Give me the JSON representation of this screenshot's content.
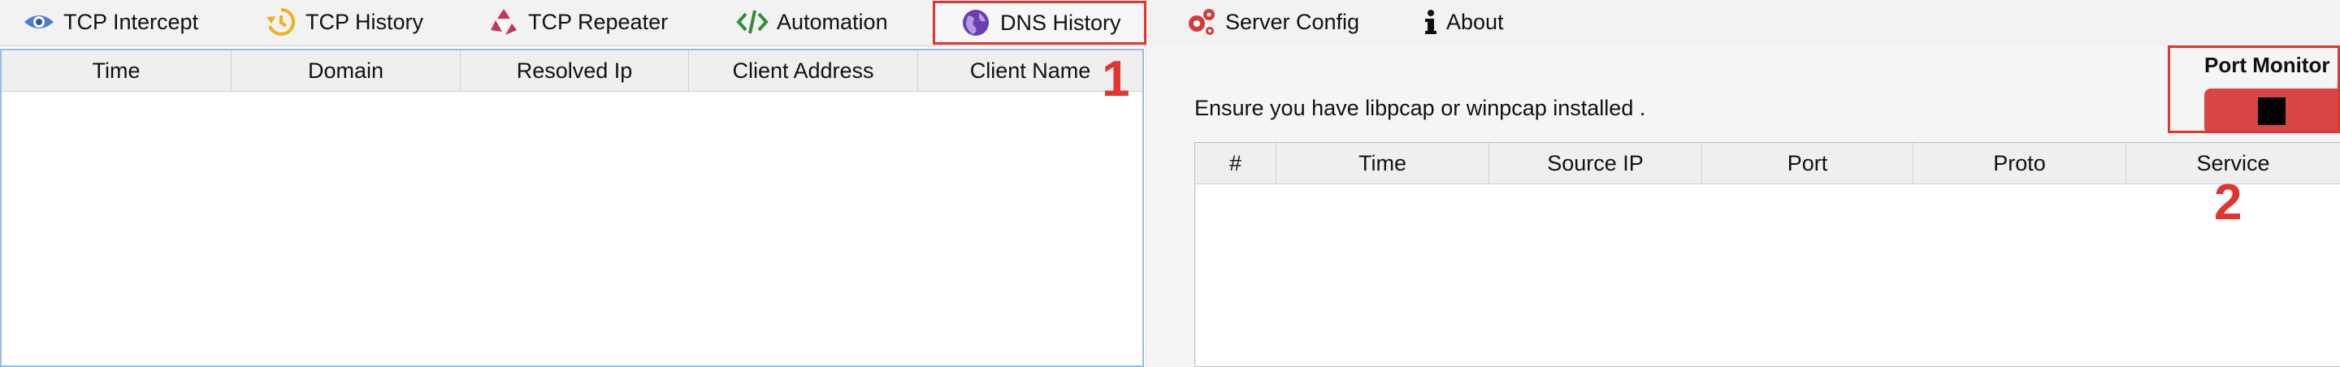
{
  "tabs": [
    {
      "label": "TCP Intercept",
      "icon": "eye-icon"
    },
    {
      "label": "TCP History",
      "icon": "history-icon"
    },
    {
      "label": "TCP Repeater",
      "icon": "recycle-icon"
    },
    {
      "label": "Automation",
      "icon": "code-icon"
    },
    {
      "label": "DNS History",
      "icon": "globe-icon",
      "active": true
    },
    {
      "label": "Server Config",
      "icon": "gears-icon"
    },
    {
      "label": "About",
      "icon": "info-icon"
    }
  ],
  "dns_table": {
    "columns": [
      "Time",
      "Domain",
      "Resolved Ip",
      "Client Address",
      "Client Name"
    ],
    "rows": []
  },
  "annotations": {
    "one": "1",
    "two": "2"
  },
  "port_monitor": {
    "label": "Port Monitor",
    "info": "Ensure you have libpcap or winpcap installed .",
    "columns": [
      "#",
      "Time",
      "Source IP",
      "Port",
      "Proto",
      "Service"
    ],
    "rows": []
  },
  "colors": {
    "highlight": "#e3342f",
    "stop_button": "#d84545",
    "selection_border": "#9bbce6"
  }
}
